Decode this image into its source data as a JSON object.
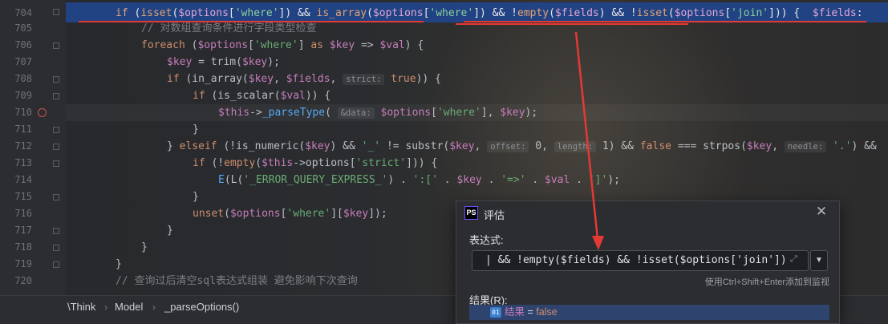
{
  "lines": [
    {
      "n": "704",
      "parts": [
        [
          "kw",
          "if "
        ],
        [
          "",
          "("
        ],
        [
          "kw",
          "isset"
        ],
        [
          "",
          "("
        ],
        [
          "var",
          "$options"
        ],
        [
          "",
          "["
        ],
        [
          "str",
          "'where'"
        ],
        [
          "",
          "]) && "
        ],
        [
          "kw",
          "is_array"
        ],
        [
          "",
          "("
        ],
        [
          "var",
          "$options"
        ],
        [
          "",
          "["
        ],
        [
          "str",
          "'where'"
        ],
        [
          "",
          "]) && !"
        ],
        [
          "kw",
          "empty"
        ],
        [
          "",
          "("
        ],
        [
          "var",
          "$fields"
        ],
        [
          "",
          ") && !"
        ],
        [
          "kw",
          "isset"
        ],
        [
          "",
          "("
        ],
        [
          "var",
          "$options"
        ],
        [
          "",
          "["
        ],
        [
          "str",
          "'join'"
        ],
        [
          "",
          "])) {  "
        ],
        [
          "var",
          "$fields"
        ],
        [
          "",
          ":"
        ]
      ]
    },
    {
      "n": "705",
      "parts": [
        [
          "cm",
          "// 对数组查询条件进行字段类型检查"
        ]
      ]
    },
    {
      "n": "706",
      "parts": [
        [
          "kw",
          "foreach "
        ],
        [
          "",
          "("
        ],
        [
          "var",
          "$options"
        ],
        [
          "",
          "["
        ],
        [
          "str",
          "'where'"
        ],
        [
          "",
          "] "
        ],
        [
          "kw",
          "as "
        ],
        [
          "var",
          "$key"
        ],
        [
          "",
          " => "
        ],
        [
          "var",
          "$val"
        ],
        [
          "",
          ") {"
        ]
      ]
    },
    {
      "n": "707",
      "parts": [
        [
          "var",
          "$key"
        ],
        [
          "",
          " = trim("
        ],
        [
          "var",
          "$key"
        ],
        [
          "",
          ");"
        ]
      ]
    },
    {
      "n": "708",
      "parts": [
        [
          "kw",
          "if "
        ],
        [
          "",
          "(in_array("
        ],
        [
          "var",
          "$key"
        ],
        [
          "",
          ", "
        ],
        [
          "var",
          "$fields"
        ],
        [
          "",
          ", "
        ],
        [
          "hint",
          "strict:"
        ],
        [
          "kw",
          " true"
        ],
        [
          "",
          "))"
        ],
        [
          "",
          " {"
        ]
      ]
    },
    {
      "n": "709",
      "parts": [
        [
          "kw",
          "if "
        ],
        [
          "",
          "(is_scalar("
        ],
        [
          "var",
          "$val"
        ],
        [
          "",
          ")) {"
        ]
      ]
    },
    {
      "n": "710",
      "parts": [
        [
          "var",
          "$this"
        ],
        [
          "",
          "->"
        ],
        [
          "fn",
          "_parseType"
        ],
        [
          "",
          "( "
        ],
        [
          "hint",
          "&data:"
        ],
        [
          "",
          " "
        ],
        [
          "var",
          "$options"
        ],
        [
          "",
          "["
        ],
        [
          "str",
          "'where'"
        ],
        [
          "",
          "], "
        ],
        [
          "var",
          "$key"
        ],
        [
          "",
          ");"
        ]
      ]
    },
    {
      "n": "711",
      "parts": [
        [
          "",
          "}"
        ]
      ]
    },
    {
      "n": "712",
      "parts": [
        [
          "",
          "} "
        ],
        [
          "kw",
          "elseif "
        ],
        [
          "",
          "(!is_numeric("
        ],
        [
          "var",
          "$key"
        ],
        [
          "",
          ") && "
        ],
        [
          "str",
          "'_'"
        ],
        [
          "",
          " != substr("
        ],
        [
          "var",
          "$key"
        ],
        [
          "",
          ", "
        ],
        [
          "hint",
          "offset:"
        ],
        [
          "",
          " 0, "
        ],
        [
          "hint",
          "length:"
        ],
        [
          "",
          " 1) && "
        ],
        [
          "kw",
          "false "
        ],
        [
          "",
          ""
        ],
        [
          "",
          "=== strpos("
        ],
        [
          "var",
          "$key"
        ],
        [
          "",
          ", "
        ],
        [
          "hint",
          "needle:"
        ],
        [
          "str",
          " '.'"
        ],
        [
          "",
          ") && "
        ]
      ]
    },
    {
      "n": "713",
      "parts": [
        [
          "kw",
          "if "
        ],
        [
          "",
          "(!"
        ],
        [
          "kw",
          "empty"
        ],
        [
          "",
          "("
        ],
        [
          "var",
          "$this"
        ],
        [
          "",
          "->options["
        ],
        [
          "str",
          "'strict'"
        ],
        [
          "",
          "])) {"
        ]
      ]
    },
    {
      "n": "714",
      "parts": [
        [
          "fn",
          "E"
        ],
        [
          "",
          "(L("
        ],
        [
          "str",
          "'_ERROR_QUERY_EXPRESS_'"
        ],
        [
          "",
          ") . "
        ],
        [
          "str",
          "':['"
        ],
        [
          "",
          " . "
        ],
        [
          "var",
          "$key"
        ],
        [
          "",
          " . "
        ],
        [
          "str",
          "'=>'"
        ],
        [
          "",
          " . "
        ],
        [
          "var",
          "$val"
        ],
        [
          "",
          " . "
        ],
        [
          "str",
          "']'"
        ],
        [
          "",
          ");"
        ]
      ]
    },
    {
      "n": "715",
      "parts": [
        [
          "",
          "}"
        ]
      ]
    },
    {
      "n": "716",
      "parts": [
        [
          "kw",
          "unset"
        ],
        [
          "",
          "("
        ],
        [
          "var",
          "$options"
        ],
        [
          "",
          "["
        ],
        [
          "str",
          "'where'"
        ],
        [
          "",
          "]["
        ],
        [
          "var",
          "$key"
        ],
        [
          "",
          "]);"
        ]
      ]
    },
    {
      "n": "717",
      "parts": [
        [
          "",
          "}"
        ]
      ]
    },
    {
      "n": "718",
      "parts": [
        [
          "",
          "}"
        ]
      ]
    },
    {
      "n": "719",
      "parts": [
        [
          "",
          "}"
        ]
      ]
    },
    {
      "n": "720",
      "parts": [
        [
          "cm",
          "// 查询过后清空sql表达式组装 避免影响下次查询"
        ]
      ]
    }
  ],
  "breadcrumb": {
    "items": [
      "\\Think",
      "Model",
      "_parseOptions()"
    ],
    "sep": "›"
  },
  "dialog": {
    "icon": "PS",
    "title": "评估",
    "close": "✕",
    "expression_label": "表达式:",
    "expression": "| && !empty($fields) && !isset($options['join'])",
    "expand_icon": "⤢",
    "dropdown_icon": "▼",
    "hint": "使用Ctrl+Shift+Enter添加到监视",
    "result_label": "结果(R):",
    "result_icon": "01",
    "result_name": "结果",
    "result_eq": " = ",
    "result_value": "false"
  },
  "colors": {
    "highlight": "#214283",
    "annotation": "#e53935",
    "breakpoint": "#d25252"
  },
  "icons": [
    "breakpoint-icon",
    "fold-icon",
    "close-icon",
    "expand-icon",
    "chevron-down-icon",
    "result-type-icon",
    "phpstorm-icon"
  ]
}
